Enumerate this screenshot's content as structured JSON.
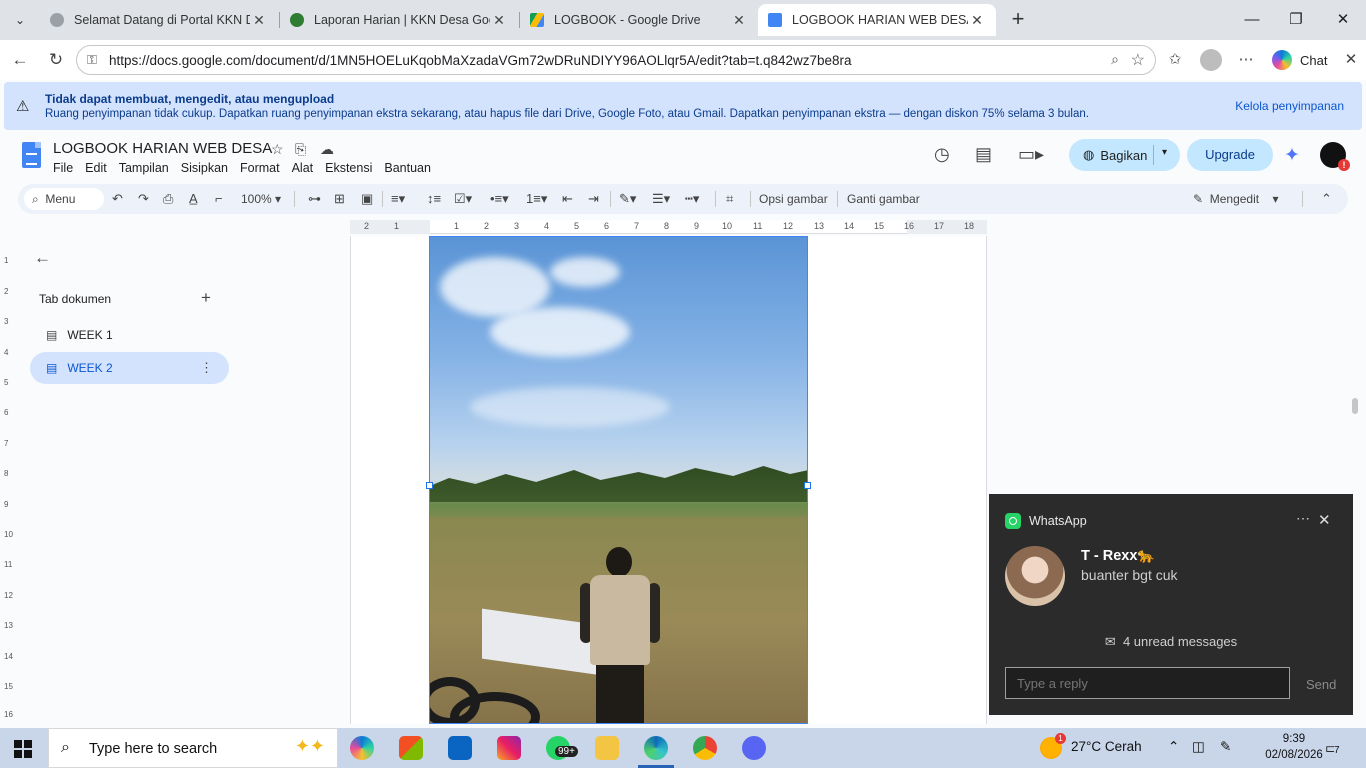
{
  "browser": {
    "tabs": [
      {
        "title": "Selamat Datang di Portal KKN Desa",
        "favicon_color": "#9aa0a6",
        "active": false
      },
      {
        "title": "Laporan Harian | KKN Desa Gogik",
        "favicon_color": "#2e7d32",
        "active": false
      },
      {
        "title": "LOGBOOK - Google Drive",
        "favicon_color": "#fbbc04",
        "active": false
      },
      {
        "title": "LOGBOOK HARIAN WEB DESA - Go",
        "favicon_color": "#4285f4",
        "active": true
      }
    ],
    "url": "https://docs.google.com/document/d/1MN5HOELuKqobMaXzadaVGm72wDRuNDIYY96AOLlqr5A/edit?tab=t.q842wz7be8ra",
    "chat_label": "Chat"
  },
  "banner": {
    "title": "Tidak dapat membuat, mengedit, atau mengupload",
    "message": "Ruang penyimpanan tidak cukup. Dapatkan ruang penyimpanan ekstra sekarang, atau hapus file dari Drive, Google Foto, atau Gmail. Dapatkan penyimpanan ekstra — dengan diskon 75% selama 3 bulan.",
    "action": "Kelola penyimpanan"
  },
  "doc": {
    "title": "LOGBOOK HARIAN WEB DESA",
    "menu": [
      "File",
      "Edit",
      "Tampilan",
      "Sisipkan",
      "Format",
      "Alat",
      "Ekstensi",
      "Bantuan"
    ],
    "share_label": "Bagikan",
    "upgrade_label": "Upgrade"
  },
  "toolbar": {
    "search_label": "Menu",
    "zoom": "100%",
    "image_options": "Opsi gambar",
    "replace_image": "Ganti gambar",
    "mode": "Mengedit"
  },
  "sidebar": {
    "header": "Tab dokumen",
    "tabs": [
      {
        "label": "WEEK 1",
        "active": false
      },
      {
        "label": "WEEK 2",
        "active": true
      }
    ]
  },
  "ruler": {
    "h_ticks": [
      "2",
      "1",
      "1",
      "2",
      "3",
      "4",
      "5",
      "6",
      "7",
      "8",
      "9",
      "10",
      "11",
      "12",
      "13",
      "14",
      "15",
      "16",
      "17",
      "18"
    ],
    "v_ticks": [
      "1",
      "2",
      "3",
      "4",
      "5",
      "6",
      "7",
      "8",
      "9",
      "10",
      "11",
      "12",
      "13",
      "14",
      "15",
      "16"
    ]
  },
  "whatsapp": {
    "app": "WhatsApp",
    "sender": "T - Rexx🐆",
    "message": "buanter bgt cuk",
    "unread": "4 unread messages",
    "reply_placeholder": "Type a reply",
    "send_label": "Send"
  },
  "taskbar": {
    "search_placeholder": "Type here to search",
    "whatsapp_badge": "99+",
    "weather": "27°C  Cerah",
    "weather_badge": "1",
    "time": "9:39",
    "date": "02/08/2026",
    "notifications": "7"
  }
}
